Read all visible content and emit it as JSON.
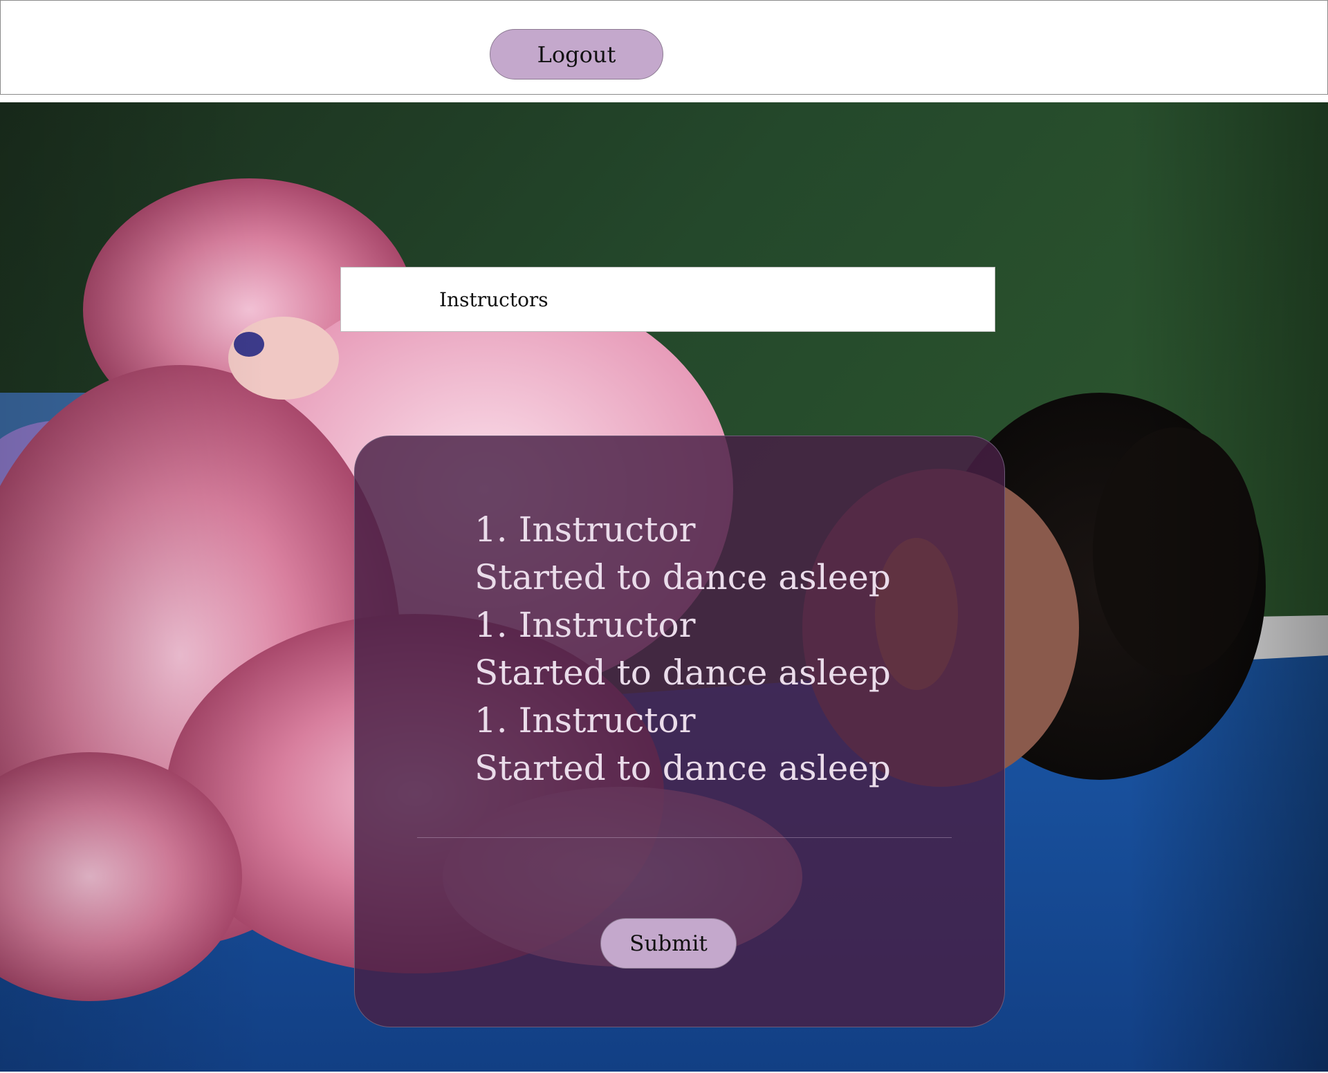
{
  "header": {
    "logout_label": "Logout"
  },
  "page": {
    "section_label": "Instructors"
  },
  "instructors": [
    {
      "name": "1. Instructor",
      "description": "Started to dance asleep"
    },
    {
      "name": "1. Instructor",
      "description": "Started to dance asleep"
    },
    {
      "name": "1. Instructor",
      "description": "Started to dance asleep"
    }
  ],
  "form": {
    "submit_label": "Submit"
  },
  "colors": {
    "button_fill": "#c4a8cc",
    "card_overlay": "#482046",
    "card_text": "#eadcea"
  }
}
